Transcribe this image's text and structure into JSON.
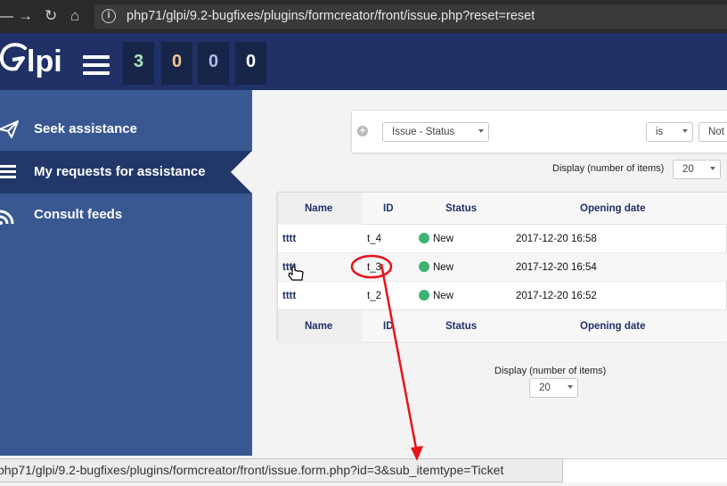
{
  "browser": {
    "url": "php71/glpi/9.2-bugfixes/plugins/formcreator/front/issue.php?reset=reset",
    "status_url": "php71/glpi/9.2-bugfixes/plugins/formcreator/front/issue.form.php?id=3&sub_itemtype=Ticket"
  },
  "header": {
    "logo_text": "lpi",
    "counters": [
      {
        "value": "3",
        "color": "#a8e6b8"
      },
      {
        "value": "0",
        "color": "#f2c68c"
      },
      {
        "value": "0",
        "color": "#b8b8f0"
      },
      {
        "value": "0",
        "color": "#ffffff"
      }
    ]
  },
  "sidebar": {
    "items": [
      {
        "label": "Seek assistance",
        "icon": "paper-plane-icon"
      },
      {
        "label": "My requests for assistance",
        "icon": "list-icon"
      },
      {
        "label": "Consult feeds",
        "icon": "rss-feed-icon"
      }
    ]
  },
  "search": {
    "field": "Issue - Status",
    "operator": "is",
    "value": "Not"
  },
  "display": {
    "label": "Display (number of items)",
    "value": "20"
  },
  "table": {
    "columns": [
      "Name",
      "ID",
      "Status",
      "Opening date"
    ],
    "rows": [
      {
        "name": "tttt",
        "id": "t_4",
        "status": "New",
        "date": "2017-12-20 16:58"
      },
      {
        "name": "tttt",
        "id": "t_3",
        "status": "New",
        "date": "2017-12-20 16:54"
      },
      {
        "name": "tttt",
        "id": "t_2",
        "status": "New",
        "date": "2017-12-20 16:52"
      }
    ]
  },
  "colors": {
    "header_bg": "#1f3166",
    "sidebar_bg": "#395891",
    "sidebar_active": "#22386a",
    "status_new": "#3cb371",
    "annotation": "#e8141a"
  }
}
